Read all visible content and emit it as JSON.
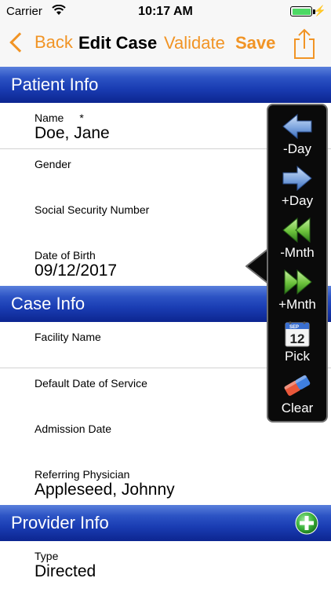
{
  "status_bar": {
    "carrier": "Carrier",
    "time": "10:17 AM",
    "battery_level": 1.0
  },
  "nav": {
    "back_label": "Back",
    "title": "Edit Case",
    "validate_label": "Validate",
    "save_label": "Save",
    "share_icon": "share-icon"
  },
  "sections": {
    "patient": {
      "title": "Patient Info",
      "rows": [
        {
          "label": "Name",
          "required": "*",
          "value": "Doe, Jane"
        },
        {
          "label": "Gender",
          "value": ""
        },
        {
          "label": "Social Security Number",
          "value": ""
        },
        {
          "label": "Date of Birth",
          "value": "09/12/2017"
        }
      ]
    },
    "case": {
      "title": "Case Info",
      "rows": [
        {
          "label": "Facility Name",
          "value": ""
        },
        {
          "label": "Default Date of Service",
          "value": ""
        },
        {
          "label": "Admission Date",
          "value": ""
        },
        {
          "label": "Referring Physician",
          "value": "Appleseed, Johnny"
        }
      ]
    },
    "provider": {
      "title": "Provider Info",
      "add_icon": "add-icon",
      "rows": [
        {
          "label": "Type",
          "value": "Directed"
        }
      ]
    }
  },
  "date_popover": {
    "items": [
      {
        "label": "-Day",
        "icon": "arrow-left-icon"
      },
      {
        "label": "+Day",
        "icon": "arrow-right-icon"
      },
      {
        "label": "-Mnth",
        "icon": "double-arrow-left-icon"
      },
      {
        "label": "+Mnth",
        "icon": "double-arrow-right-icon"
      },
      {
        "label": "Pick",
        "icon": "calendar-icon",
        "calendar_day": "12",
        "calendar_month": "SEP"
      },
      {
        "label": "Clear",
        "icon": "eraser-icon"
      }
    ]
  },
  "colors": {
    "accent": "#f19425",
    "header_blue": "#1a3db3",
    "add_green": "#3cb43c"
  }
}
